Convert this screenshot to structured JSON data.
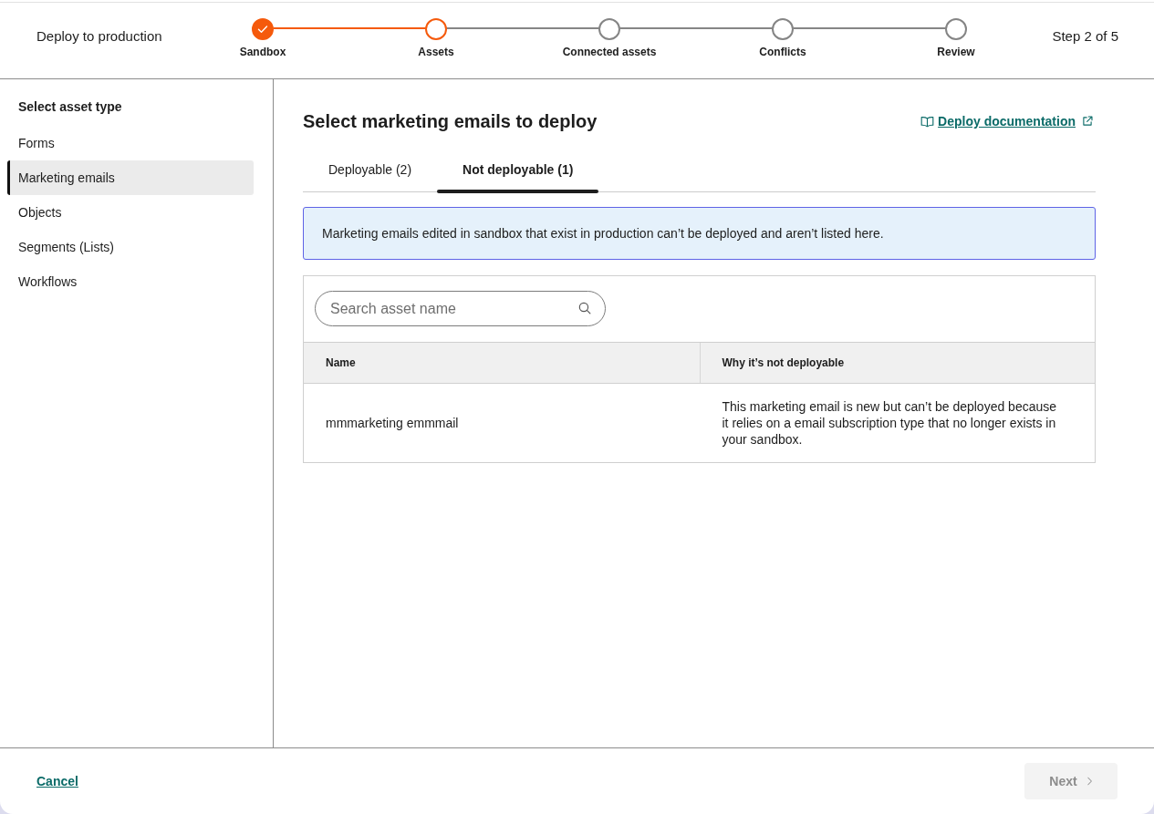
{
  "header": {
    "title": "Deploy to production",
    "steps": [
      {
        "label": "Sandbox",
        "completed": true,
        "active": false
      },
      {
        "label": "Assets",
        "completed": false,
        "active": true
      },
      {
        "label": "Connected assets",
        "completed": false,
        "active": false
      },
      {
        "label": "Conflicts",
        "completed": false,
        "active": false
      },
      {
        "label": "Review",
        "completed": false,
        "active": false
      }
    ],
    "step_count": "Step 2 of 5"
  },
  "sidebar": {
    "heading": "Select asset type",
    "items": [
      {
        "label": "Forms",
        "selected": false
      },
      {
        "label": "Marketing emails",
        "selected": true
      },
      {
        "label": "Objects",
        "selected": false
      },
      {
        "label": "Segments (Lists)",
        "selected": false
      },
      {
        "label": "Workflows",
        "selected": false
      }
    ]
  },
  "main": {
    "title": "Select marketing emails to deploy",
    "doc_link": "Deploy documentation",
    "tabs": [
      {
        "label": "Deployable (2)",
        "selected": false
      },
      {
        "label": "Not deployable (1)",
        "selected": true
      }
    ],
    "alert": "Marketing emails edited in sandbox that exist in production can’t be deployed and aren’t listed here.",
    "search": {
      "placeholder": "Search asset name"
    },
    "table": {
      "columns": [
        "Name",
        "Why it’s not deployable"
      ],
      "rows": [
        [
          "mmmarketing emmmail",
          "This marketing email is new but can’t be deployed because it relies on a email subscription type that no longer exists in your sandbox."
        ]
      ]
    }
  },
  "footer": {
    "cancel": "Cancel",
    "next": {
      "label": "Next",
      "disabled": true
    }
  }
}
